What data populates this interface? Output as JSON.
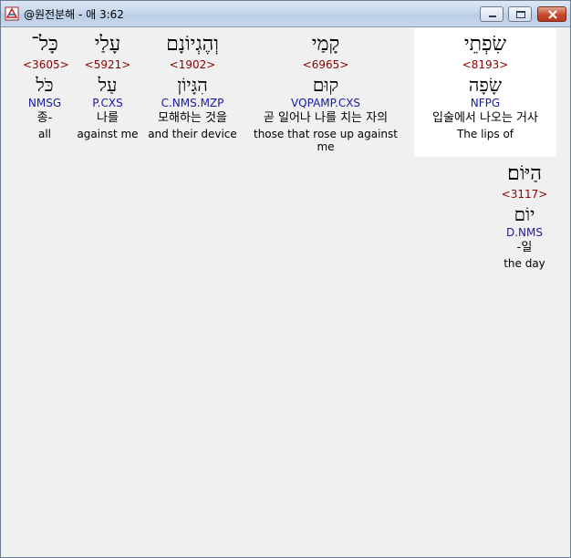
{
  "window": {
    "title": "@원전분해 - 애 3:62",
    "icons": {
      "app": "app-icon",
      "minimize": "minimize-icon",
      "maximize": "maximize-icon",
      "close": "close-icon"
    },
    "close_color": "#c8482a"
  },
  "words": [
    {
      "hebrew": "כָּל־",
      "strongs": "<3605>",
      "lemma": "כֹּל",
      "parsing": "NMSG",
      "korean": "종-",
      "english": "all"
    },
    {
      "hebrew": "עָלַי",
      "strongs": "<5921>",
      "lemma": "עַל",
      "parsing": "P.CXS",
      "korean": "나를",
      "english": "against me"
    },
    {
      "hebrew": "וְהֶגְיוֹנָם",
      "strongs": "<1902>",
      "lemma": "הִגָּיוֹן",
      "parsing": "C.NMS.MZP",
      "korean": "모해하는 것을",
      "english": "and their device"
    },
    {
      "hebrew": "קָמַי",
      "strongs": "<6965>",
      "lemma": "קוּם",
      "parsing": "VQPAMP.CXS",
      "korean": "곧 일어나 나를 치는 자의",
      "english": "those that rose up against me"
    },
    {
      "hebrew": "שִׂפְתֵי",
      "strongs": "<8193>",
      "lemma": "שָׂפָה",
      "parsing": "NFPG",
      "korean": "입술에서 나오는 거사",
      "english": "The lips of"
    },
    {
      "hebrew": "הַיּוֹם׃",
      "strongs": "<3117>",
      "lemma": "יוֹם",
      "parsing": "D.NMS",
      "korean": "-일",
      "english": "the day"
    }
  ],
  "colors": {
    "strongs": "#8b0000",
    "parsing": "#1a1aa0",
    "highlight": "#ffffff",
    "background": "#f0f0f0"
  }
}
